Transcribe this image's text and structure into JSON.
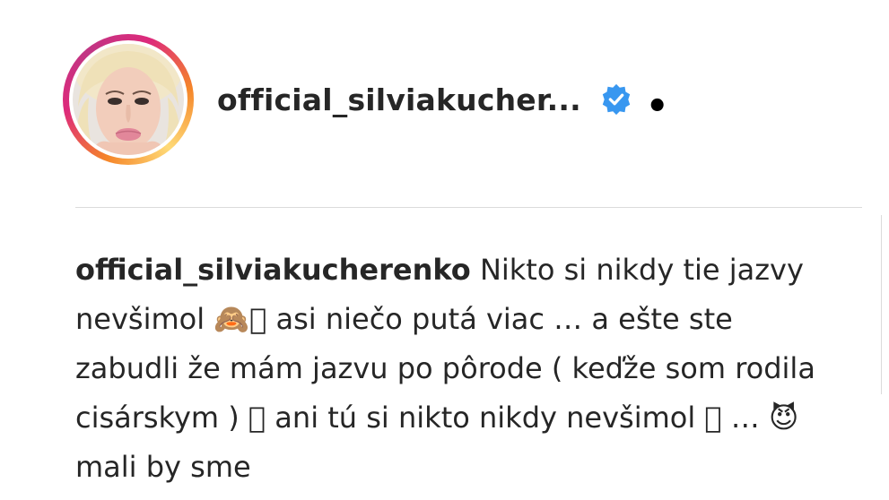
{
  "post": {
    "username": "official_silviakucher...",
    "username_symbol": "•",
    "verified_icon": "verified-badge-icon",
    "colors": {
      "ring_gradient": [
        "#f58529",
        "#dd2a7b",
        "#c13584",
        "#feda77"
      ],
      "verified_blue": "#3897f0",
      "text": "#262626",
      "divider": "#dbdbdb"
    }
  },
  "caption": {
    "username": "official_silviakucherenko",
    "text": "Nikto si nikdy tie jazvy nevšimol 🙈󾓥 asi niečo putá viac … a ešte ste zabudli že mám jazvu po pôrode ( keďže som rodila cisárskym ) 󾓗 ani tú si nikto nikdy nevšimol 󾓨 … 😈 mali by sme"
  }
}
